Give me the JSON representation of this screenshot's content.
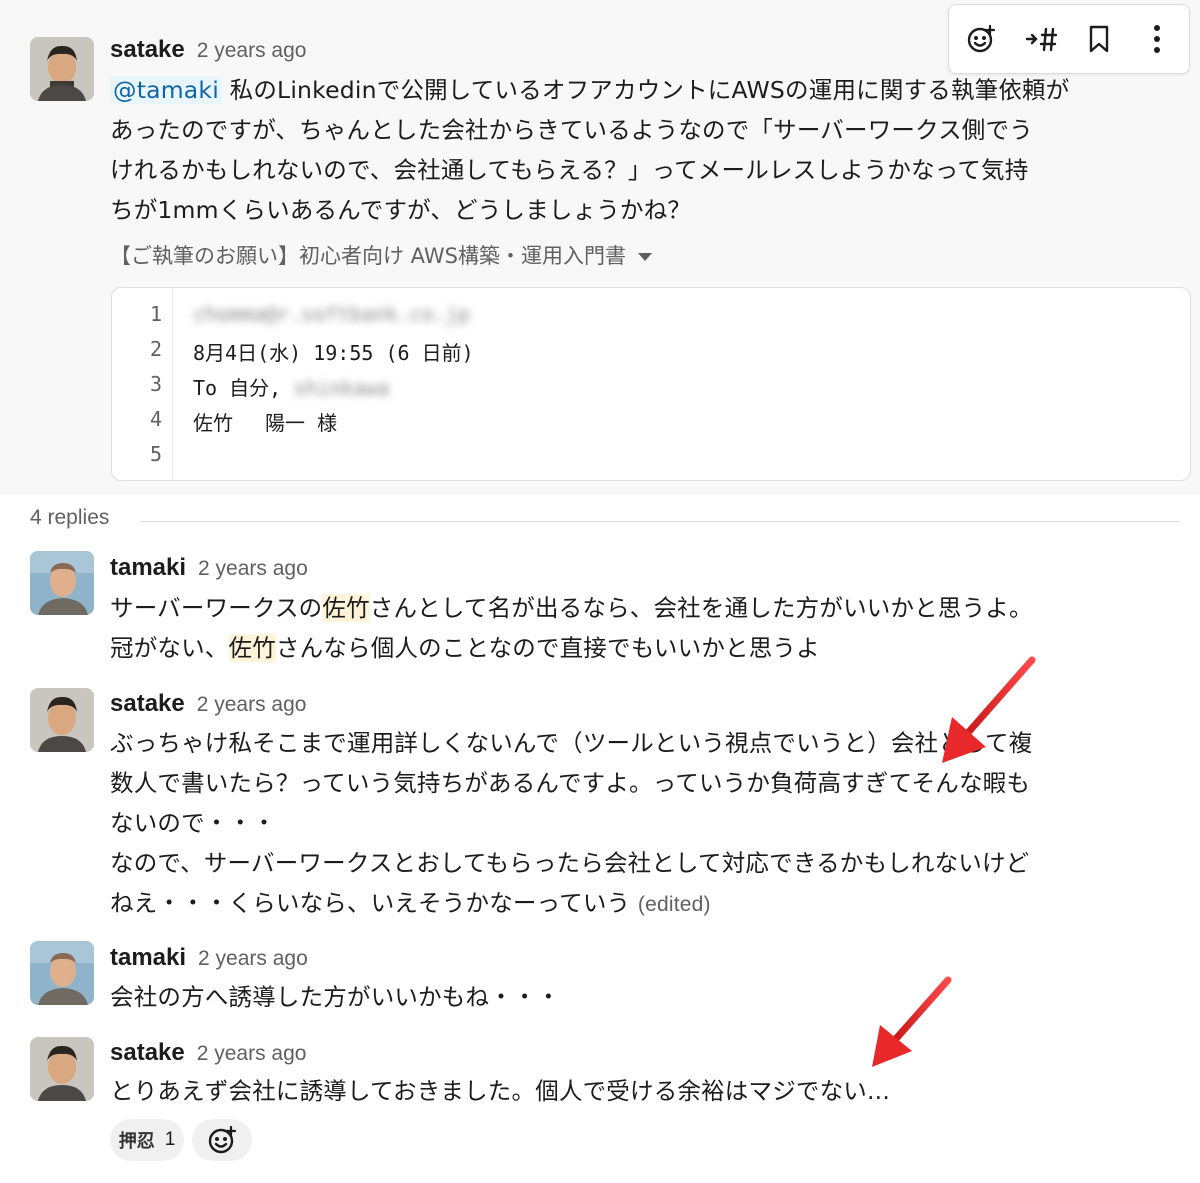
{
  "toolbar": {
    "icons": [
      "add-reaction-icon",
      "forward-channel-icon",
      "bookmark-icon",
      "more-actions-icon"
    ]
  },
  "parent": {
    "user": "satake",
    "time": "2 years ago",
    "mention": "@tamaki",
    "lines": [
      " 私のLinkedinで公開しているオフアカウントにAWSの運用に関する執筆依頼が",
      "あったのですが、ちゃんとした会社からきているようなので「サーバーワークス側でう",
      "けれるかもしれないので、会社通してもらえる？」ってメールレスしようかなって気持",
      "ちが1mmくらいあるんですが、どうしましょうかね？"
    ],
    "attachment": {
      "title": "【ご執筆のお願い】初心者向け AWS構築・運用入門書",
      "line_numbers": [
        "1",
        "2",
        "3",
        "4",
        "5"
      ],
      "lines": [
        "chomma@r.softbank.co.jp",
        "8月4日(水) 19:55 (6 日前)",
        "To 自分, ",
        "佐竹　 陽一 様",
        ""
      ],
      "line3_blurred": "shinkawa"
    }
  },
  "thread": {
    "replies_label": "4 replies"
  },
  "replies": [
    {
      "user": "tamaki",
      "time": "2 years ago",
      "l1a": "サーバーワークスの",
      "l1b": "佐竹",
      "l1c": "さんとして名が出るなら、会社を通した方がいいかと思うよ。",
      "l2a": "冠がない、",
      "l2b": "佐竹",
      "l2c": "さんなら個人のことなので直接でもいいかと思うよ"
    },
    {
      "user": "satake",
      "time": "2 years ago",
      "lines": [
        "ぶっちゃけ私そこまで運用詳しくないんで（ツールという視点でいうと）会社として複",
        "数人で書いたら？っていう気持ちがあるんですよ。っていうか負荷高すぎてそんな暇も",
        "ないので・・・",
        "なので、サーバーワークスとおしてもらったら会社として対応できるかもしれないけど",
        "ねえ・・・くらいなら、いえそうかなーっていう "
      ],
      "edited": "(edited)"
    },
    {
      "user": "tamaki",
      "time": "2 years ago",
      "lines": [
        "会社の方へ誘導した方がいいかもね・・・"
      ]
    },
    {
      "user": "satake",
      "time": "2 years ago",
      "lines": [
        "とりあえず会社に誘導しておきました。個人で受ける余裕はマジでない..."
      ],
      "reactions": [
        {
          "emoji": "押忍",
          "count": "1"
        }
      ],
      "add_reaction_icon": "add-reaction-icon"
    }
  ],
  "colors": {
    "link": "#1264a3",
    "mention_bg": "#e8f5fa",
    "highlight_bg": "#fef4d9",
    "annotation_arrow": "#e8282a"
  }
}
